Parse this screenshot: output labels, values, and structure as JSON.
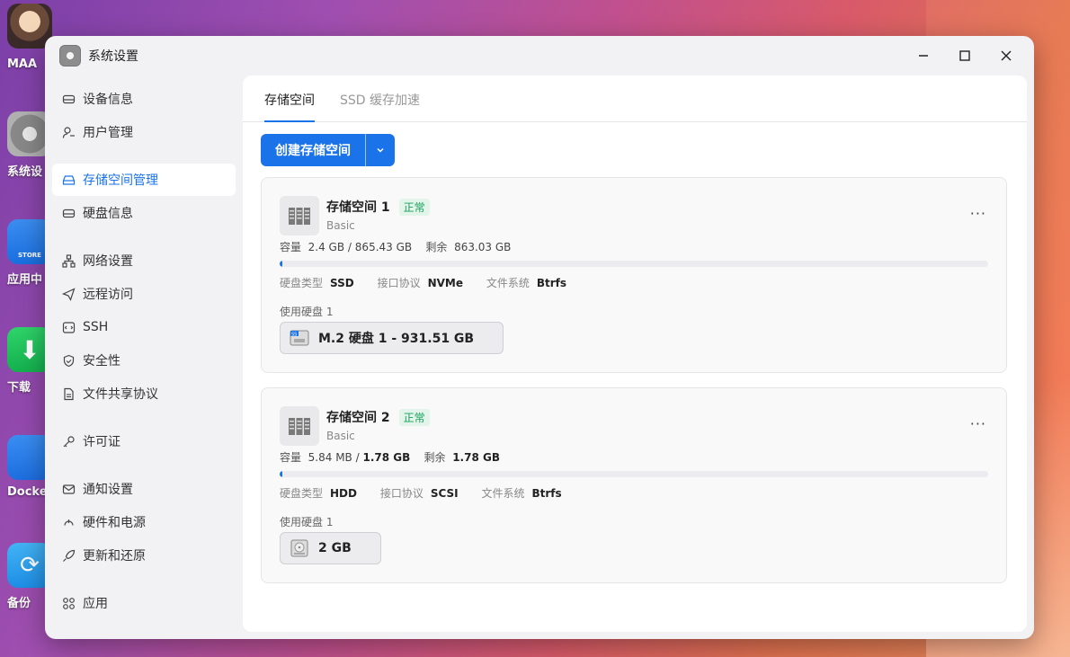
{
  "desktop": {
    "items": [
      {
        "label": "MAA"
      },
      {
        "label": "系统设"
      },
      {
        "label": "应用中"
      },
      {
        "label": "下载"
      },
      {
        "label": "Docke"
      },
      {
        "label": "备份"
      }
    ],
    "store_text": "STORE"
  },
  "window": {
    "title": "系统设置"
  },
  "sidebar": {
    "items": [
      {
        "label": "设备信息",
        "icon": "device-icon"
      },
      {
        "label": "用户管理",
        "icon": "user-icon"
      },
      {
        "label": "存储空间管理",
        "icon": "storage-icon"
      },
      {
        "label": "硬盘信息",
        "icon": "disk-icon"
      },
      {
        "label": "网络设置",
        "icon": "network-icon"
      },
      {
        "label": "远程访问",
        "icon": "send-icon"
      },
      {
        "label": "SSH",
        "icon": "terminal-icon"
      },
      {
        "label": "安全性",
        "icon": "shield-icon"
      },
      {
        "label": "文件共享协议",
        "icon": "file-icon"
      },
      {
        "label": "许可证",
        "icon": "key-icon"
      },
      {
        "label": "通知设置",
        "icon": "mail-icon"
      },
      {
        "label": "硬件和电源",
        "icon": "power-icon"
      },
      {
        "label": "更新和还原",
        "icon": "rocket-icon"
      },
      {
        "label": "应用",
        "icon": "apps-icon"
      }
    ],
    "active": "存储空间管理"
  },
  "tabs": [
    {
      "label": "存储空间",
      "active": true
    },
    {
      "label": "SSD 缓存加速",
      "active": false
    }
  ],
  "toolbar": {
    "create_label": "创建存储空间"
  },
  "pools": [
    {
      "name": "存储空间 1",
      "status": "正常",
      "type": "Basic",
      "capacity_label": "容量",
      "used": "2.4 GB",
      "separator": "/",
      "total": "865.43 GB",
      "remaining_label": "剩余",
      "remaining": "863.03 GB",
      "usage_fraction": 0.003,
      "disk_type_label": "硬盘类型",
      "disk_type": "SSD",
      "protocol_label": "接口协议",
      "protocol": "NVMe",
      "fs_label": "文件系统",
      "fs": "Btrfs",
      "used_disks_label": "使用硬盘 1",
      "disk_name": "M.2 硬盘 1 - 931.51 GB",
      "disk_icon": "nvme-disk-icon",
      "disk_icon_text": "SS"
    },
    {
      "name": "存储空间 2",
      "status": "正常",
      "type": "Basic",
      "capacity_label": "容量",
      "used": "5.84 MB",
      "separator": "/",
      "total": "1.78 GB",
      "remaining_label": "剩余",
      "remaining": "1.78 GB",
      "usage_fraction": 0.003,
      "disk_type_label": "硬盘类型",
      "disk_type": "HDD",
      "protocol_label": "接口协议",
      "protocol": "SCSI",
      "fs_label": "文件系统",
      "fs": "Btrfs",
      "used_disks_label": "使用硬盘 1",
      "disk_name": "2 GB",
      "disk_icon": "hdd-disk-icon"
    }
  ],
  "colors": {
    "accent": "#1a73e8",
    "status_green": "#19a05b"
  }
}
